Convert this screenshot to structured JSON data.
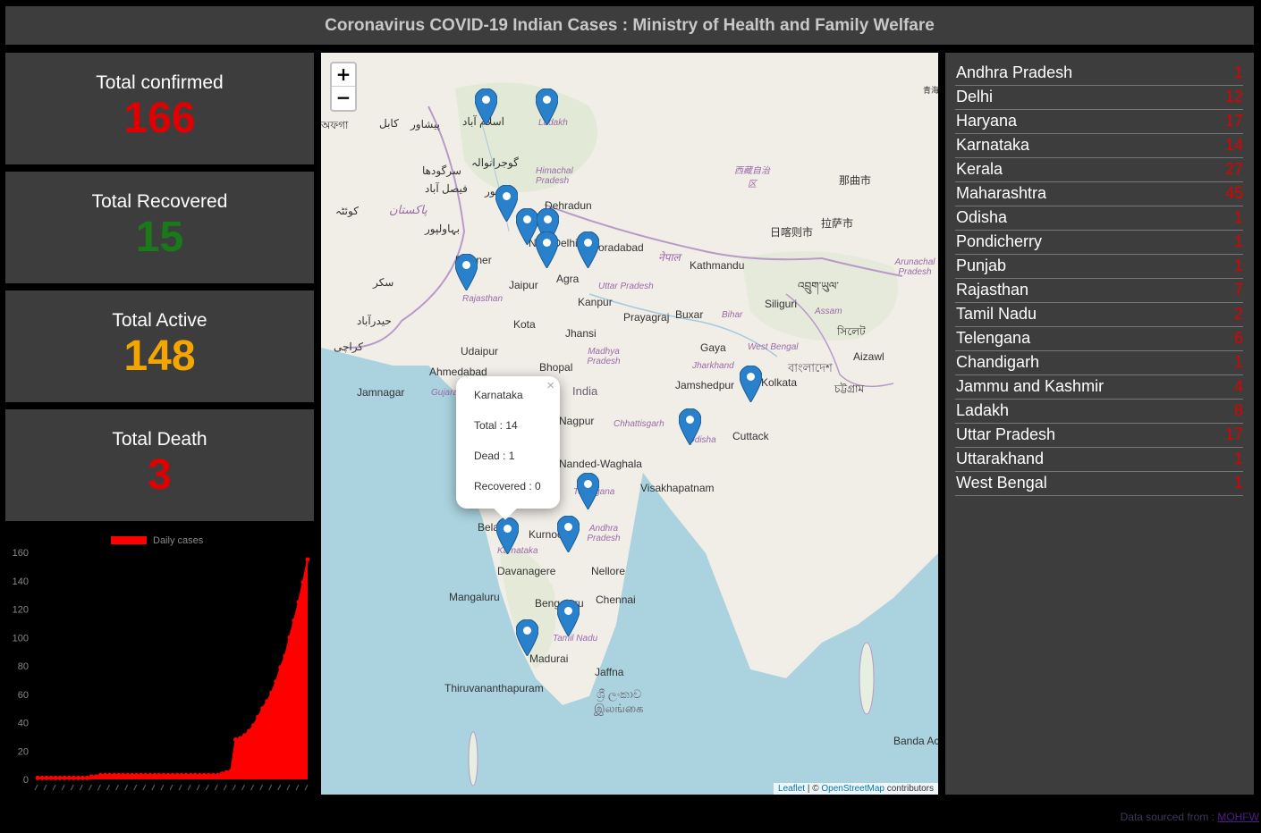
{
  "header": {
    "title": "Coronavirus COVID-19 Indian Cases : Ministry of Health and Family Welfare"
  },
  "stats": {
    "confirmed": {
      "label": "Total confirmed",
      "value": "166",
      "color": "#e00000"
    },
    "recovered": {
      "label": "Total Recovered",
      "value": "15",
      "color": "#1a7a1a"
    },
    "active": {
      "label": "Total Active",
      "value": "148",
      "color": "#f5a500"
    },
    "death": {
      "label": "Total Death",
      "value": "3",
      "color": "#e00000"
    }
  },
  "chart_data": {
    "type": "area",
    "series": [
      {
        "name": "Daily cases",
        "color": "#ff0000"
      }
    ],
    "values": [
      1,
      1,
      1,
      1,
      1,
      1,
      1,
      1,
      1,
      1,
      1,
      1,
      2,
      2,
      3,
      3,
      3,
      3,
      3,
      3,
      3,
      3,
      3,
      3,
      3,
      3,
      3,
      3,
      3,
      3,
      3,
      3,
      3,
      3,
      3,
      3,
      3,
      3,
      3,
      3,
      3,
      4,
      5,
      6,
      28,
      29,
      31,
      34,
      38,
      44,
      50,
      55,
      61,
      69,
      79,
      87,
      100,
      112,
      125,
      139,
      155
    ],
    "ylim": [
      0,
      160
    ],
    "yticks": [
      "0",
      "20",
      "40",
      "60",
      "80",
      "100",
      "120",
      "140",
      "160"
    ],
    "legend": "top",
    "grid": false
  },
  "map": {
    "zoom_in": "+",
    "zoom_out": "−",
    "places": [
      {
        "text": "اسلام آباد"
      },
      {
        "text": "پیشاور"
      },
      {
        "text": "کابل"
      },
      {
        "text": "گوجرانوالہ"
      },
      {
        "text": "سرگودھا"
      },
      {
        "text": "فیصل آباد"
      },
      {
        "text": "لاہور"
      },
      {
        "text": "کوئٹہ"
      },
      {
        "text": "پاکستان"
      },
      {
        "text": "بہاولپور"
      },
      {
        "text": "سکر"
      },
      {
        "text": "حیدرآباد"
      },
      {
        "text": "کراچی"
      },
      {
        "text": "Himachal Pradesh"
      },
      {
        "text": "Ladakh"
      },
      {
        "text": "Dehradun"
      },
      {
        "text": "New Delhi"
      },
      {
        "text": "Moradabad"
      },
      {
        "text": "Bikaner"
      },
      {
        "text": "Jaipur"
      },
      {
        "text": "Agra"
      },
      {
        "text": "Rajasthan"
      },
      {
        "text": "Uttar Pradesh"
      },
      {
        "text": "Kanpur"
      },
      {
        "text": "Kota"
      },
      {
        "text": "Jhansi"
      },
      {
        "text": "Prayagraj"
      },
      {
        "text": "Buxar"
      },
      {
        "text": "Bihar"
      },
      {
        "text": "Udaipur"
      },
      {
        "text": "Madhya Pradesh"
      },
      {
        "text": "Gaya"
      },
      {
        "text": "Ahmedabad"
      },
      {
        "text": "Bhopal"
      },
      {
        "text": "Jharkhand"
      },
      {
        "text": "India"
      },
      {
        "text": "Jamnagar"
      },
      {
        "text": "Gujarat"
      },
      {
        "text": "Jamshedpur"
      },
      {
        "text": "Kolkata"
      },
      {
        "text": "Nagpur"
      },
      {
        "text": "Chhattisgarh"
      },
      {
        "text": "Odisha"
      },
      {
        "text": "Cuttack"
      },
      {
        "text": "Nanded-Waghala"
      },
      {
        "text": "Visakhapatnam"
      },
      {
        "text": "Telangana"
      },
      {
        "text": "Belagavi"
      },
      {
        "text": "Kurnool"
      },
      {
        "text": "Andhra Pradesh"
      },
      {
        "text": "Karnataka"
      },
      {
        "text": "Davanagere"
      },
      {
        "text": "Nellore"
      },
      {
        "text": "Mangaluru"
      },
      {
        "text": "Bengaluru"
      },
      {
        "text": "Chennai"
      },
      {
        "text": "Tamil Nadu"
      },
      {
        "text": "Madurai"
      },
      {
        "text": "Jaffna"
      },
      {
        "text": "Thiruvananthapuram"
      },
      {
        "text": "ශ්‍රී ලංකාව"
      },
      {
        "text": "இலங்கை"
      },
      {
        "text": "Kathmandu"
      },
      {
        "text": "नेपाल"
      },
      {
        "text": "Siliguri"
      },
      {
        "text": "Assam"
      },
      {
        "text": "West Bengal"
      },
      {
        "text": "বাংলাদেশ"
      },
      {
        "text": "Aizawl"
      },
      {
        "text": "সিলেট"
      },
      {
        "text": "চট্টগ্রাম"
      },
      {
        "text": "西藏自治区"
      },
      {
        "text": "那曲市"
      },
      {
        "text": "拉萨市"
      },
      {
        "text": "日喀则市"
      },
      {
        "text": "Arunachal Pradesh"
      },
      {
        "text": "འབྲུག་ཡུལ་"
      },
      {
        "text": "Banda Aceh"
      },
      {
        "text": "青海"
      },
      {
        "text": "অফগা"
      }
    ],
    "popup": {
      "close": "×",
      "title": "Karnataka",
      "total": "Total : 14",
      "dead": "Dead : 1",
      "recovered": "Recovered : 0"
    },
    "attribution": {
      "leaflet": "Leaflet",
      "sep": " | © ",
      "osm": "OpenStreetMap",
      "tail": " contributors"
    }
  },
  "states": [
    {
      "name": "Andhra Pradesh",
      "count": "1"
    },
    {
      "name": "Delhi",
      "count": "12"
    },
    {
      "name": "Haryana",
      "count": "17"
    },
    {
      "name": "Karnataka",
      "count": "14"
    },
    {
      "name": "Kerala",
      "count": "27"
    },
    {
      "name": "Maharashtra",
      "count": "45"
    },
    {
      "name": "Odisha",
      "count": "1"
    },
    {
      "name": "Pondicherry",
      "count": "1"
    },
    {
      "name": "Punjab",
      "count": "1"
    },
    {
      "name": "Rajasthan",
      "count": "7"
    },
    {
      "name": "Tamil Nadu",
      "count": "2"
    },
    {
      "name": "Telengana",
      "count": "6"
    },
    {
      "name": "Chandigarh",
      "count": "1"
    },
    {
      "name": "Jammu and Kashmir",
      "count": "4"
    },
    {
      "name": "Ladakh",
      "count": "8"
    },
    {
      "name": "Uttar Pradesh",
      "count": "17"
    },
    {
      "name": "Uttarakhand",
      "count": "1"
    },
    {
      "name": "West Bengal",
      "count": "1"
    }
  ],
  "footer": {
    "text": "Data sourced from : ",
    "link": "MOHFW"
  }
}
